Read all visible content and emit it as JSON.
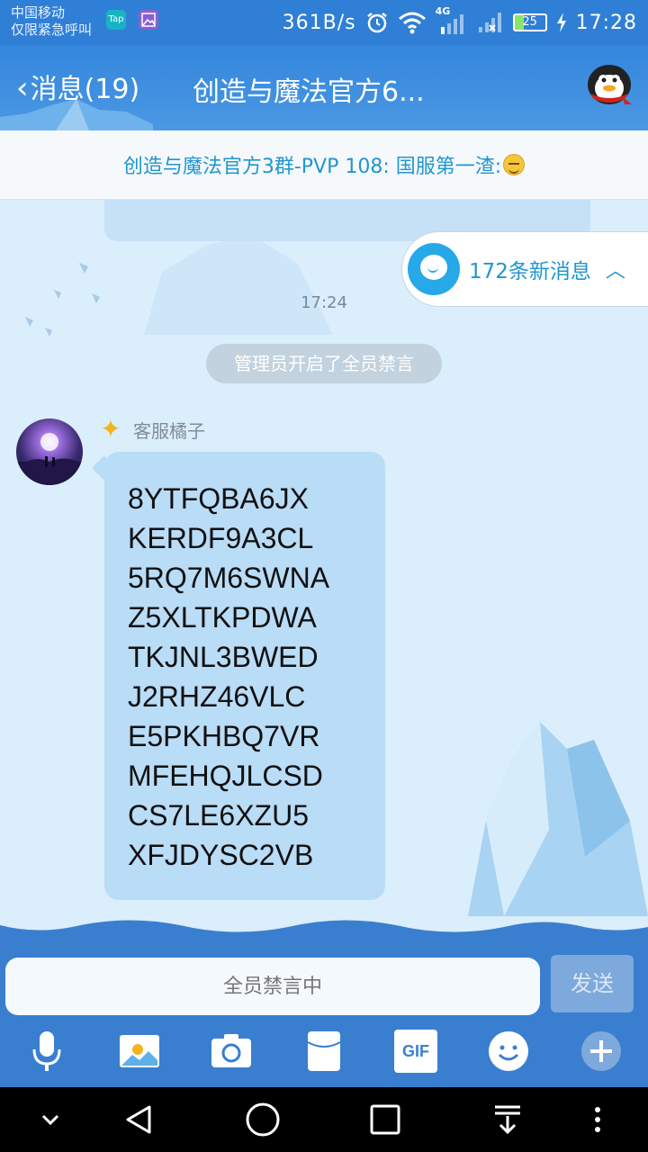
{
  "status_bar": {
    "carrier_line1": "中国移动",
    "carrier_line2": "仅限紧急呼叫",
    "app_icon_1": "Tap",
    "net_speed": "361B/s",
    "network_type": "4G",
    "battery": "25",
    "time": "17:28"
  },
  "header": {
    "back_label": "消息(19)",
    "title": "创造与魔法官方6..."
  },
  "notice": {
    "text": "创造与魔法官方3群-PVP 108:  国服第一渣:"
  },
  "chat": {
    "new_messages": "172条新消息",
    "timestamp": "17:24",
    "system_message": "管理员开启了全员禁言",
    "sender_name": "客服橘子",
    "codes": [
      "8YTFQBA6JX",
      "KERDF9A3CL",
      "5RQ7M6SWNA",
      "Z5XLTKPDWA",
      "TKJNL3BWED",
      "J2RHZ46VLC",
      "E5PKHBQ7VR",
      "MFEHQJLCSD",
      "CS7LE6XZU5",
      "XFJDYSC2VB"
    ]
  },
  "input": {
    "placeholder": "全员禁言中",
    "send_label": "发送"
  },
  "toolbar": {
    "gif_label": "GIF",
    "icons": [
      "microphone-icon",
      "image-icon",
      "camera-icon",
      "red-packet-icon",
      "gif-icon",
      "emoji-icon",
      "plus-icon"
    ]
  },
  "colors": {
    "header_blue": "#3386dc",
    "accent": "#2196cf",
    "bubble": "#b9dcf7",
    "chat_bg": "#dbeefc"
  }
}
